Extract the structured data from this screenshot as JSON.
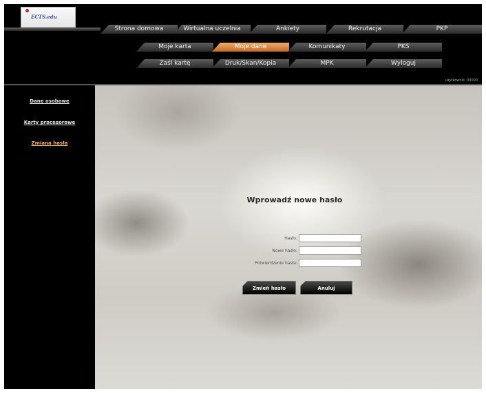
{
  "logo": {
    "text": "ECTS.edu"
  },
  "nav": {
    "row1": [
      "Strona domowa",
      "Wirtualna uczelnia",
      "Ankiety",
      "Rekrutacja",
      "PKP"
    ],
    "row2": [
      "Moje karta",
      "Moje dane",
      "Komunikaty",
      "PKS"
    ],
    "row3": [
      "Zaśl kartę",
      "Druk/Skan/Kopia",
      "MPK",
      "Wyloguj"
    ]
  },
  "user": {
    "label": "użytkownik: 00000"
  },
  "sidebar": {
    "items": [
      {
        "label": "Dane osobowe"
      },
      {
        "label": "Karty procesorowe"
      },
      {
        "label": "Zmiana hasła"
      }
    ]
  },
  "form": {
    "title": "Wprowadź nowe hasło",
    "fields": [
      {
        "label": "Hasło:",
        "value": ""
      },
      {
        "label": "Nowe hasło:",
        "value": ""
      },
      {
        "label": "Potwierdzenie hasła:",
        "value": ""
      }
    ],
    "submit_label": "Zmień hasło",
    "cancel_label": "Anuluj"
  }
}
